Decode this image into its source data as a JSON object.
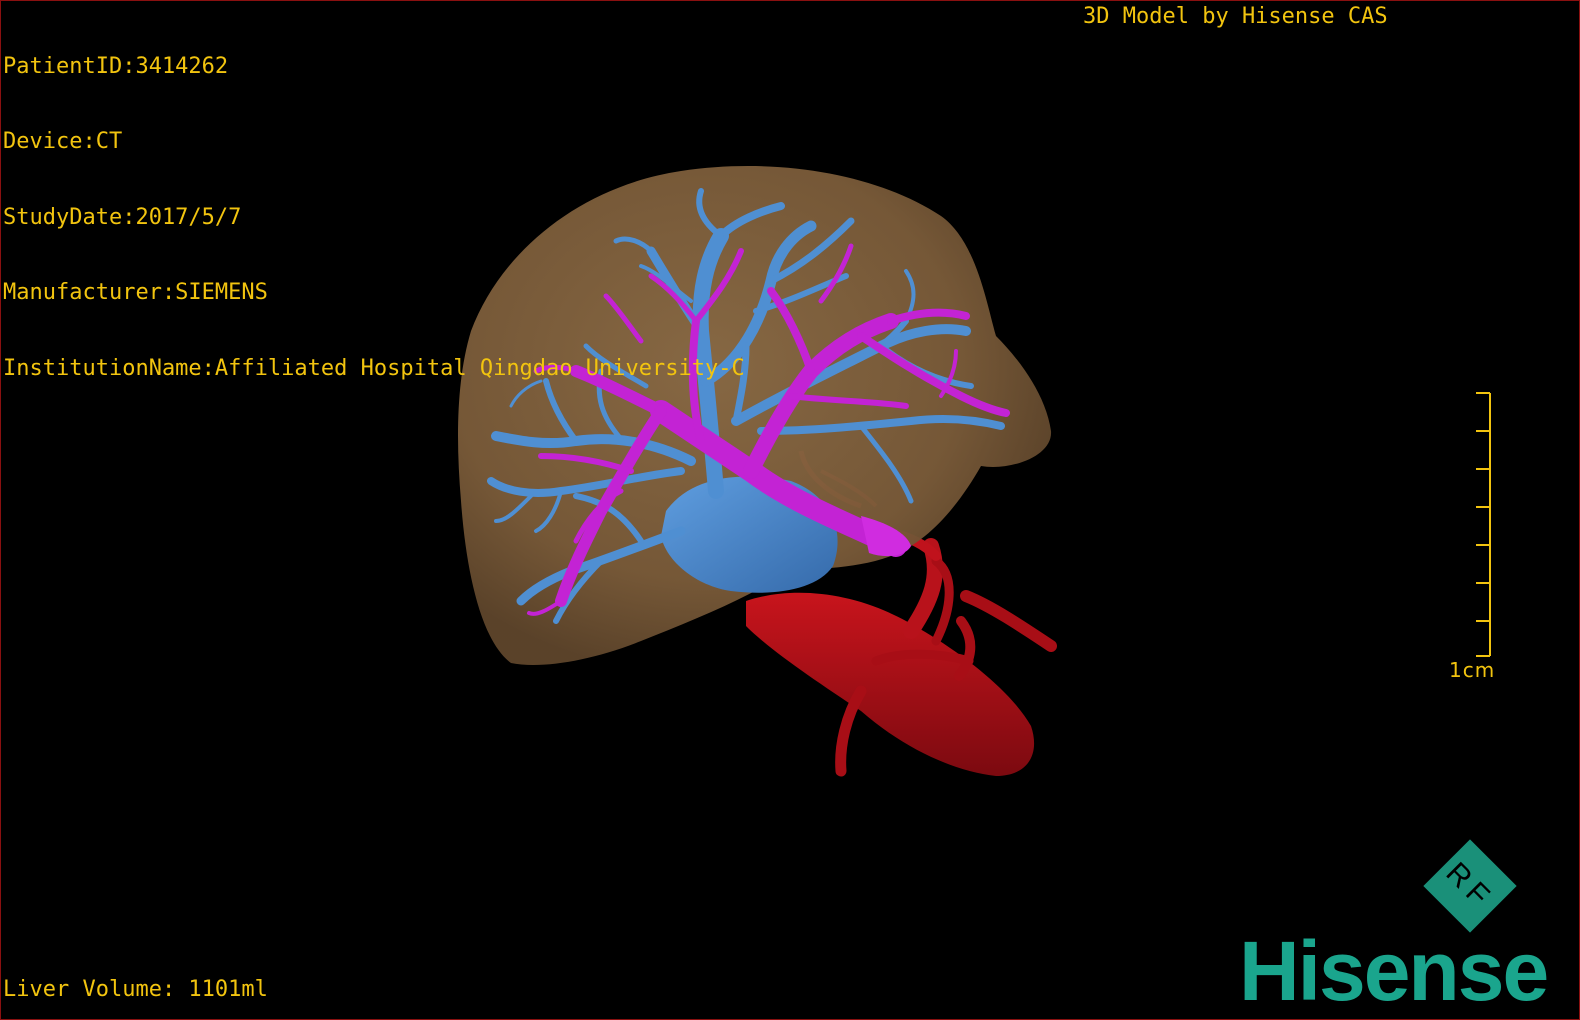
{
  "study_info": {
    "patient_id": "PatientID:3414262",
    "device": "Device:CT",
    "study_date": "StudyDate:2017/5/7",
    "manufacturer": "Manufacturer:SIEMENS",
    "institution": "InstitutionName:Affiliated Hospital Qingdao University-C"
  },
  "credit": "3D Model by Hisense CAS",
  "liver_volume": "Liver Volume: 1101ml",
  "scale_bar": {
    "label": "1cm"
  },
  "logo": {
    "mark_text": "RF",
    "brand": "Hisense"
  },
  "colors": {
    "overlay_text": "#f2c40f",
    "liver": "#8a6a45",
    "portal_vein": "#c020d0",
    "hepatic_vein": "#4a88cc",
    "artery": "#b0101a",
    "brand": "#1aa58d"
  }
}
